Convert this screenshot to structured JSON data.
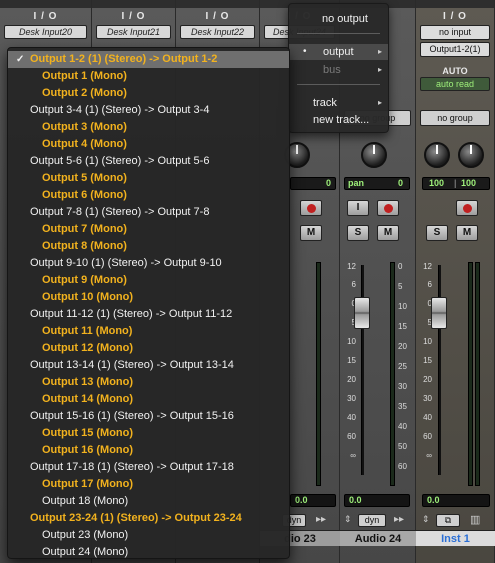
{
  "strips": [
    {
      "io": "I / O",
      "desk": "Desk Input20"
    },
    {
      "io": "I / O",
      "desk": "Desk Input21"
    },
    {
      "io": "I / O",
      "desk": "Desk Input22"
    },
    {
      "io": "I / O",
      "desk": "Desk Input24"
    }
  ],
  "inst_strip": {
    "io": "I / O",
    "input": "no input",
    "output": "Output1-2(1)",
    "auto_label": "AUTO",
    "auto_mode": "auto read",
    "group": "no group",
    "pan_left": "100",
    "pan_right": "100",
    "solo": "S",
    "mute": "M",
    "volume": "0.0",
    "name": "Inst 1"
  },
  "audio24_strip": {
    "group": "no group",
    "pan_label": "pan",
    "pan_value": "0",
    "input_btn": "I",
    "solo": "S",
    "mute": "M",
    "volume": "0.0",
    "dyn": "dyn",
    "name": "Audio 24"
  },
  "audio23_strip": {
    "pan_value": "0",
    "mute": "M",
    "volume": "0.0",
    "dyn": "dyn",
    "name": "dio 23"
  },
  "fader_scale": [
    "12",
    "6",
    "0",
    "5",
    "10",
    "15",
    "20",
    "30",
    "40",
    "60",
    "∞"
  ],
  "meter_scale": [
    "0",
    "5",
    "10",
    "15",
    "20",
    "25",
    "30",
    "35",
    "40",
    "50",
    "60"
  ],
  "submenu": {
    "no_output": "no output",
    "output": "output",
    "bus": "bus",
    "track": "track",
    "new_track": "new track..."
  },
  "dropdown_items": [
    {
      "label": "Output 1-2 (1) (Stereo) -> Output 1-2",
      "kind": "stereo",
      "hl": true,
      "selected": true
    },
    {
      "label": "Output 1 (Mono)",
      "kind": "mono",
      "hl": true
    },
    {
      "label": "Output 2 (Mono)",
      "kind": "mono",
      "hl": true
    },
    {
      "label": "Output 3-4 (1) (Stereo) -> Output 3-4",
      "kind": "stereo",
      "hl": false
    },
    {
      "label": "Output 3 (Mono)",
      "kind": "mono",
      "hl": true
    },
    {
      "label": "Output 4 (Mono)",
      "kind": "mono",
      "hl": true
    },
    {
      "label": "Output 5-6 (1) (Stereo) -> Output 5-6",
      "kind": "stereo",
      "hl": false
    },
    {
      "label": "Output 5 (Mono)",
      "kind": "mono",
      "hl": true
    },
    {
      "label": "Output 6 (Mono)",
      "kind": "mono",
      "hl": true
    },
    {
      "label": "Output 7-8 (1) (Stereo) -> Output 7-8",
      "kind": "stereo",
      "hl": false
    },
    {
      "label": "Output 7 (Mono)",
      "kind": "mono",
      "hl": true
    },
    {
      "label": "Output 8 (Mono)",
      "kind": "mono",
      "hl": true
    },
    {
      "label": "Output 9-10 (1) (Stereo) -> Output 9-10",
      "kind": "stereo",
      "hl": false
    },
    {
      "label": "Output 9 (Mono)",
      "kind": "mono",
      "hl": true
    },
    {
      "label": "Output 10 (Mono)",
      "kind": "mono",
      "hl": true
    },
    {
      "label": "Output 11-12 (1) (Stereo) -> Output 11-12",
      "kind": "stereo",
      "hl": false
    },
    {
      "label": "Output 11 (Mono)",
      "kind": "mono",
      "hl": true
    },
    {
      "label": "Output 12 (Mono)",
      "kind": "mono",
      "hl": true
    },
    {
      "label": "Output 13-14 (1) (Stereo) -> Output 13-14",
      "kind": "stereo",
      "hl": false
    },
    {
      "label": "Output 13 (Mono)",
      "kind": "mono",
      "hl": true
    },
    {
      "label": "Output 14 (Mono)",
      "kind": "mono",
      "hl": true
    },
    {
      "label": "Output 15-16 (1) (Stereo) -> Output 15-16",
      "kind": "stereo",
      "hl": false
    },
    {
      "label": "Output 15 (Mono)",
      "kind": "mono",
      "hl": true
    },
    {
      "label": "Output 16 (Mono)",
      "kind": "mono",
      "hl": true
    },
    {
      "label": "Output 17-18 (1) (Stereo) -> Output 17-18",
      "kind": "stereo",
      "hl": false
    },
    {
      "label": "Output 17 (Mono)",
      "kind": "mono",
      "hl": true
    },
    {
      "label": "Output 18 (Mono)",
      "kind": "mono",
      "hl": false
    },
    {
      "label": "Output 23-24 (1) (Stereo) -> Output 23-24",
      "kind": "stereo",
      "hl": true
    },
    {
      "label": "Output 23 (Mono)",
      "kind": "mono",
      "hl": false
    },
    {
      "label": "Output 24 (Mono)",
      "kind": "mono",
      "hl": false
    }
  ],
  "colors": {
    "highlight": "#f2b21e",
    "meter_green": "#9ef07a",
    "name_blue": "#2a6fd6"
  }
}
